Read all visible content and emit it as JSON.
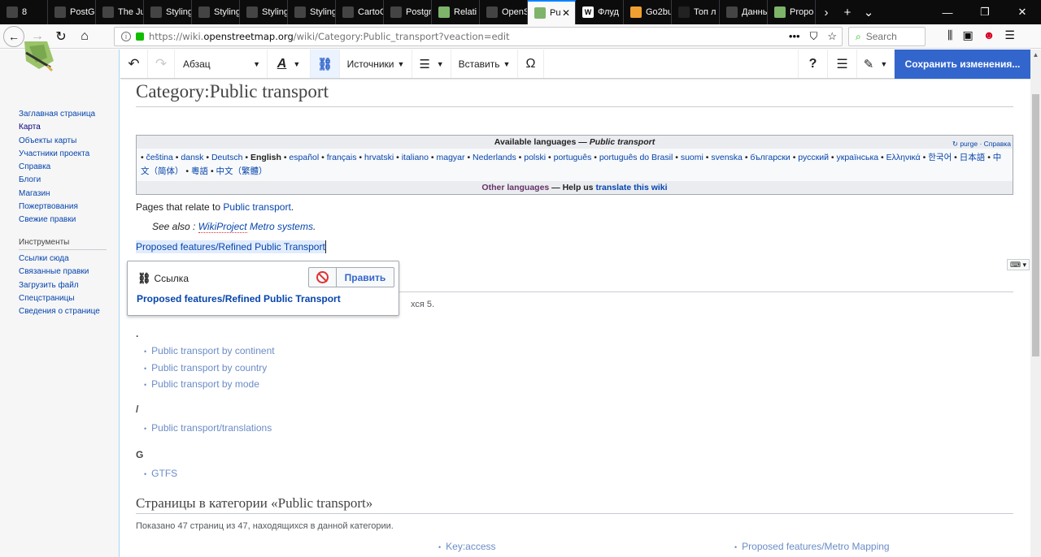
{
  "browser": {
    "tabs": [
      {
        "label": "8",
        "color": "#444"
      },
      {
        "label": "PostGIS fu",
        "color": "#444"
      },
      {
        "label": "The Jump",
        "color": "#444"
      },
      {
        "label": "Styling Lin",
        "color": "#444"
      },
      {
        "label": "Styling - C",
        "color": "#444"
      },
      {
        "label": "Styling - C",
        "color": "#444"
      },
      {
        "label": "Styling Lat",
        "color": "#444"
      },
      {
        "label": "CartoCSS",
        "color": "#444"
      },
      {
        "label": "Postgres P",
        "color": "#444"
      },
      {
        "label": "Relati",
        "color": "#7eb36a"
      },
      {
        "label": "OpenStree",
        "color": "#444"
      },
      {
        "label": "Pu",
        "color": "#7eb36a"
      },
      {
        "label": "Флуд",
        "color": "#ffffff"
      },
      {
        "label": "Go2bu",
        "color": "#f0a030"
      },
      {
        "label": "Топ л",
        "color": "#222"
      },
      {
        "label": "Данные п",
        "color": "#444"
      },
      {
        "label": "Propo",
        "color": "#7eb36a"
      }
    ],
    "url_prefix": "https://wiki.",
    "url_host": "openstreetmap.org",
    "url_path": "/wiki/Category:Public_transport?veaction=edit",
    "search_placeholder": "Search"
  },
  "sidebar": {
    "nav": [
      {
        "label": "Заглавная страница",
        "visited": false
      },
      {
        "label": "Карта",
        "visited": true
      },
      {
        "label": "Объекты карты",
        "visited": false
      },
      {
        "label": "Участники проекта",
        "visited": false
      },
      {
        "label": "Справка",
        "visited": false
      },
      {
        "label": "Блоги",
        "visited": false
      },
      {
        "label": "Магазин",
        "visited": false
      },
      {
        "label": "Пожертвования",
        "visited": false
      },
      {
        "label": "Свежие правки",
        "visited": false
      }
    ],
    "tools_heading": "Инструменты",
    "tools": [
      "Ссылки сюда",
      "Связанные правки",
      "Загрузить файл",
      "Спецстраницы",
      "Сведения о странице"
    ]
  },
  "toolbar": {
    "paragraph": "Абзац",
    "sources": "Источники",
    "insert": "Вставить",
    "help": "?",
    "save": "Сохранить изменения..."
  },
  "page": {
    "title": "Category:Public transport",
    "languages": {
      "heading_prefix": "Available languages — ",
      "heading_italic": "Public transport",
      "purge": "purge",
      "help": "Справка",
      "list": [
        "čeština",
        "dansk",
        "Deutsch",
        "English",
        "español",
        "français",
        "hrvatski",
        "italiano",
        "magyar",
        "Nederlands",
        "polski",
        "português",
        "português do Brasil",
        "suomi",
        "svenska",
        "български",
        "русский",
        "українська",
        "Ελληνικά",
        "한국어",
        "日本語",
        "中文（简体）",
        "粵語",
        "中文（繁體）"
      ],
      "current": "English",
      "other": "Other languages",
      "help_us": " — Help us ",
      "translate": "translate this wiki"
    },
    "intro_prefix": "Pages that relate to ",
    "intro_link": "Public transport",
    "intro_suffix": ".",
    "see_also_prefix": "See also : ",
    "see_also_link_1": "WikiProject",
    "see_also_link_2": " Metro systems",
    "see_also_suffix": ".",
    "selected_link": "Proposed features/Refined Public Transport",
    "subcat_count_tail": "хся 5.",
    "groups": [
      {
        "head": ".",
        "items": [
          "Public transport by continent",
          "Public transport by country",
          "Public transport by mode"
        ]
      },
      {
        "head": "/",
        "items": [
          "Public transport/translations"
        ]
      },
      {
        "head": "G",
        "items": [
          "GTFS"
        ]
      }
    ],
    "pages_heading": "Страницы в категории «Public transport»",
    "pages_count": "Показано 47 страниц из 47, находящихся в данной категории.",
    "page_links": [
      "Key:access",
      "Proposed features/Metro Mapping"
    ]
  },
  "link_popup": {
    "title": "Ссылка",
    "edit": "Править",
    "target": "Proposed features/Refined Public Transport"
  }
}
